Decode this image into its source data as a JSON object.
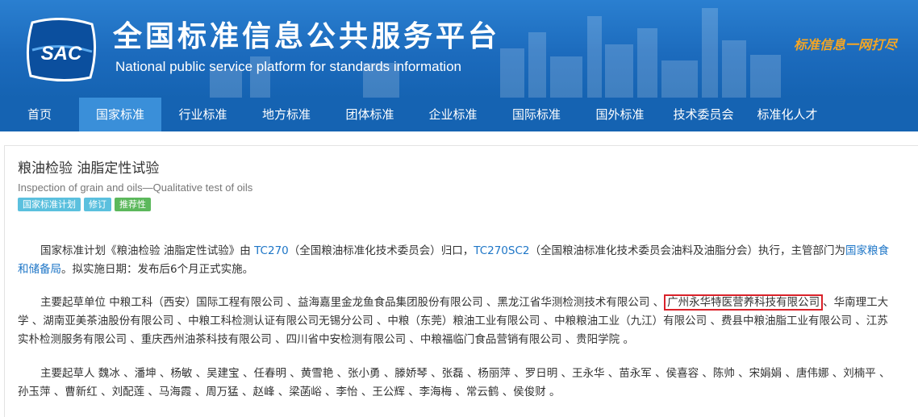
{
  "header": {
    "logo_text": "SAC",
    "title_cn": "全国标准信息公共服务平台",
    "title_en": "National public service platform  for standards information",
    "slogan": "标准信息一网打尽"
  },
  "nav": {
    "items": [
      {
        "label": "首页"
      },
      {
        "label": "国家标准"
      },
      {
        "label": "行业标准"
      },
      {
        "label": "地方标准"
      },
      {
        "label": "团体标准"
      },
      {
        "label": "企业标准"
      },
      {
        "label": "国际标准"
      },
      {
        "label": "国外标准"
      },
      {
        "label": "技术委员会"
      },
      {
        "label": "标准化人才"
      }
    ],
    "active": "国家标准"
  },
  "standard": {
    "title": "粮油检验 油脂定性试验",
    "title_en": "Inspection of grain and oils—Qualitative test of oils",
    "badges": [
      "国家标准计划",
      "修订",
      "推荐性"
    ]
  },
  "body": {
    "p1_a": "国家标准计划《粮油检验 油脂定性试验》由 ",
    "p1_tc": "TC270",
    "p1_b": "（全国粮油标准化技术委员会）归口，",
    "p1_tc2": "TC270SC2",
    "p1_c": "（全国粮油标准化技术委员会油料及油脂分会）执行，主管部门为",
    "p1_dept": "国家粮食和储备局",
    "p1_d": "。拟实施日期：发布后6个月正式实施。",
    "p2_a": "主要起草单位 中粮工科（西安）国际工程有限公司 、益海嘉里金龙鱼食品集团股份有限公司 、黑龙江省华测检测技术有限公司 、",
    "p2_highlight": "广州永华特医营养科技有限公司",
    "p2_b": "、华南理工大学 、湖南亚美茶油股份有限公司 、中粮工科检测认证有限公司无锡分公司 、中粮（东莞）粮油工业有限公司 、中粮粮油工业（九江）有限公司 、费县中粮油脂工业有限公司 、江苏实朴检测服务有限公司 、重庆西州油茶科技有限公司 、四川省中安检测有限公司 、中粮福临门食品营销有限公司 、贵阳学院 。",
    "p3": "主要起草人 魏冰 、潘坤 、杨敏 、吴建宝 、任春明 、黄雪艳 、张小勇 、滕娇琴 、张磊 、杨丽萍 、罗日明 、王永华 、苗永军 、侯喜容 、陈帅 、宋娟娟 、唐伟娜 、刘楠平 、孙玉萍 、曹新红 、刘配莲 、马海霞 、周万猛 、赵峰 、梁菡峪 、李怡 、王公辉 、李海梅 、常云鹤 、侯俊财 。"
  },
  "colors": {
    "banner": "#1c6bbd",
    "nav": "#1563b2",
    "nav_active": "#3a8fd9",
    "link": "#1e76c7",
    "highlight_border": "#d9222a",
    "badge_blue": "#5bc0de",
    "badge_green": "#5cb85c"
  }
}
